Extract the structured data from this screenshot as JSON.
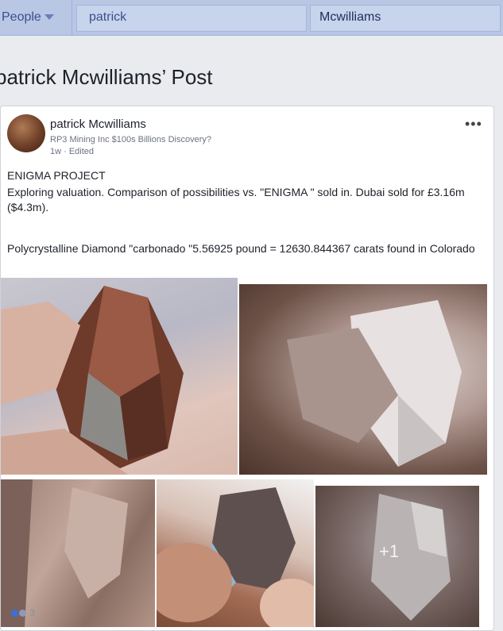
{
  "topbar": {
    "filter_label": "People",
    "first_name": "patrick",
    "last_name": "Mcwilliams"
  },
  "page": {
    "title": "patrick Mcwilliams’ Post"
  },
  "post": {
    "author": "patrick Mcwilliams",
    "group": "RP3 Mining Inc $100s Billions Discovery?",
    "time": "1w",
    "edited": "Edited",
    "text_line1": "ENIGMA PROJECT",
    "text_line2": "Exploring valuation. Comparison of possibilities vs. \"ENIGMA \" sold in. Dubai  sold for £3.16m ($4.3m).",
    "text_line3": "Polycrystalline Diamond \"carbonado \"5.56925 pound  =  12630.844367 carats found in Colorado",
    "more_photos": "+1",
    "reaction_count": "3"
  },
  "icons": {
    "more": "more-options-icon",
    "caret": "caret-down-icon"
  }
}
